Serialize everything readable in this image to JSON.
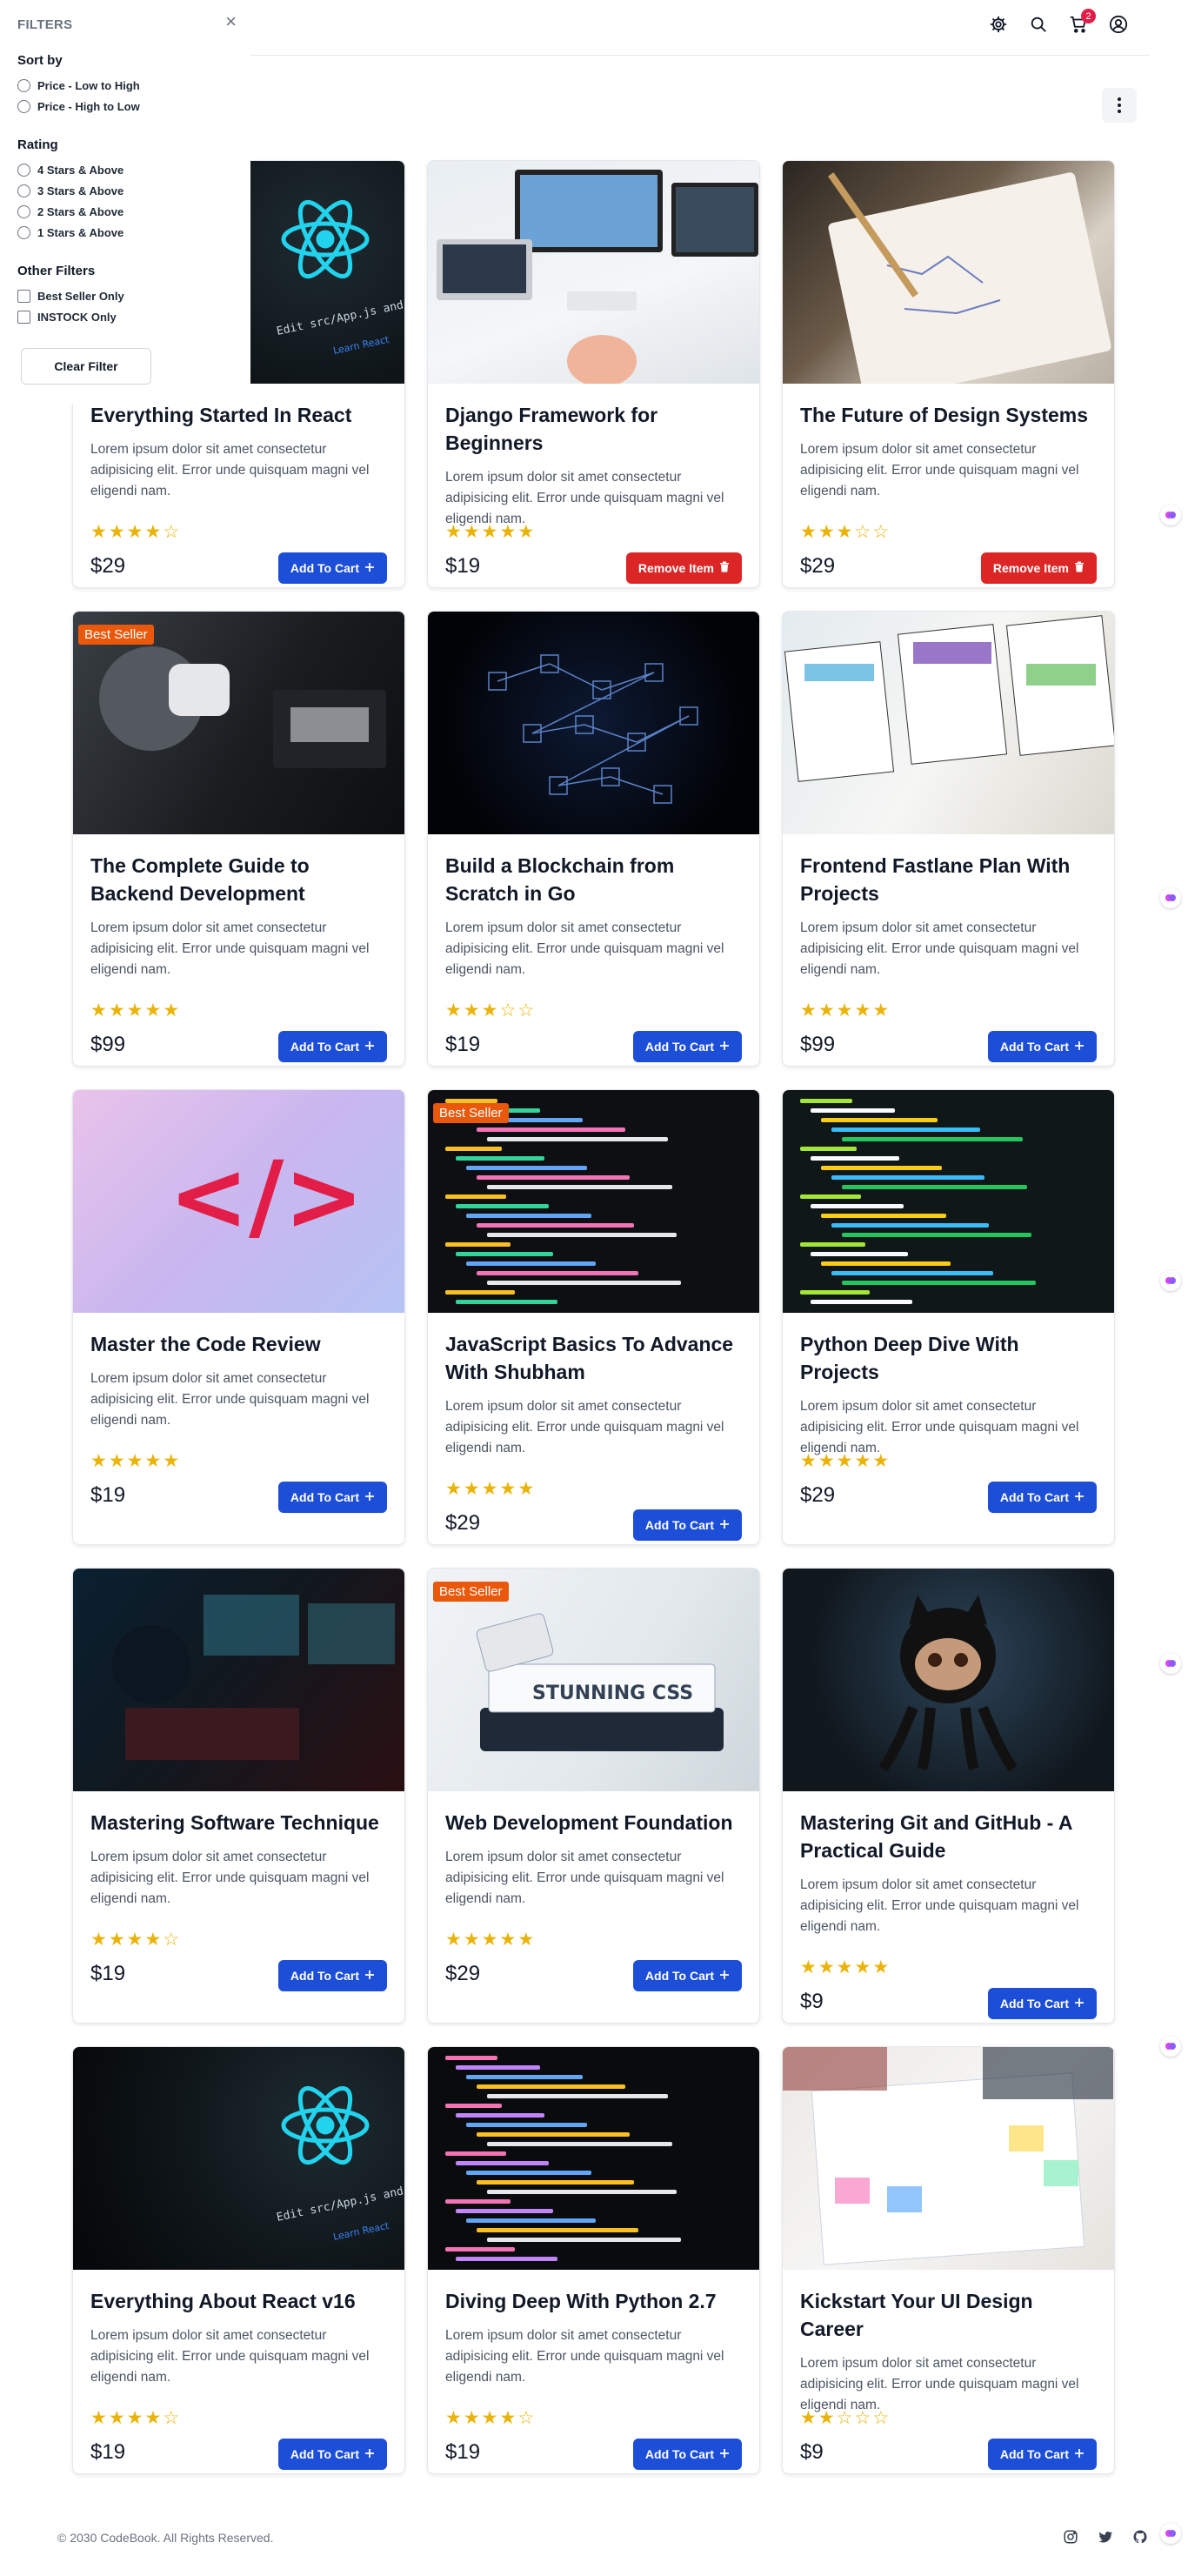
{
  "sidebar": {
    "title": "FILTERS",
    "close_symbol": "×",
    "sort_title": "Sort by",
    "sort_options": [
      "Price - Low to High",
      "Price - High to Low"
    ],
    "rating_title": "Rating",
    "rating_options": [
      "4 Stars & Above",
      "3 Stars & Above",
      "2 Stars & Above",
      "1 Stars & Above"
    ],
    "other_title": "Other Filters",
    "other_options": [
      "Best Seller Only",
      "INSTOCK Only"
    ],
    "clear_label": "Clear Filter"
  },
  "header": {
    "icons": [
      "gear-icon",
      "search-icon",
      "cart-icon",
      "user-icon"
    ],
    "cart_count": "2"
  },
  "products": [
    {
      "title": "Everything Started In React",
      "desc": "Lorem ipsum dolor sit amet consectetur adipisicing elit. Error unde quisquam magni vel eligendi nam.",
      "rating": 4,
      "price": "$29",
      "button": "Add To Cart",
      "in_cart": false,
      "best_seller": false,
      "image": "react-atom-image"
    },
    {
      "title": "Django Framework for Beginners",
      "desc": "Lorem ipsum dolor sit amet consectetur adipisicing elit. Error unde quisquam magni vel eligendi nam.",
      "rating": 5,
      "price": "$19",
      "button": "Remove Item",
      "in_cart": true,
      "best_seller": false,
      "image": "desk-setup-image"
    },
    {
      "title": "The Future of Design Systems",
      "desc": "Lorem ipsum dolor sit amet consectetur adipisicing elit. Error unde quisquam magni vel eligendi nam.",
      "rating": 3,
      "price": "$29",
      "button": "Remove Item",
      "in_cart": true,
      "best_seller": false,
      "image": "sketchbook-image"
    },
    {
      "title": "The Complete Guide to Backend Development",
      "desc": "Lorem ipsum dolor sit amet consectetur adipisicing elit. Error unde quisquam magni vel eligendi nam.",
      "rating": 5,
      "price": "$99",
      "button": "Add To Cart",
      "in_cart": false,
      "best_seller": true,
      "best_seller_label": "Best Seller",
      "image": "vr-headset-image"
    },
    {
      "title": "Build a Blockchain from Scratch in Go",
      "desc": "Lorem ipsum dolor sit amet consectetur adipisicing elit. Error unde quisquam magni vel eligendi nam.",
      "rating": 3,
      "price": "$19",
      "button": "Add To Cart",
      "in_cart": false,
      "best_seller": false,
      "image": "blockchain-image"
    },
    {
      "title": "Frontend Fastlane Plan With Projects",
      "desc": "Lorem ipsum dolor sit amet consectetur adipisicing elit. Error unde quisquam magni vel eligendi nam.",
      "rating": 5,
      "price": "$99",
      "button": "Add To Cart",
      "in_cart": false,
      "best_seller": false,
      "image": "wireframe-image"
    },
    {
      "title": "Master the Code Review",
      "desc": "Lorem ipsum dolor sit amet consectetur adipisicing elit. Error unde quisquam magni vel eligendi nam.",
      "rating": 5,
      "price": "$19",
      "button": "Add To Cart",
      "in_cart": false,
      "best_seller": false,
      "image": "code-symbol-image"
    },
    {
      "title": "JavaScript Basics To Advance With Shubham",
      "desc": "Lorem ipsum dolor sit amet consectetur adipisicing elit. Error unde quisquam magni vel eligendi nam.",
      "rating": 5,
      "price": "$29",
      "button": "Add To Cart",
      "in_cart": false,
      "best_seller": true,
      "best_seller_label": "Best Seller",
      "image": "js-code-image"
    },
    {
      "title": "Python Deep Dive With Projects",
      "desc": "Lorem ipsum dolor sit amet consectetur adipisicing elit. Error unde quisquam magni vel eligendi nam.",
      "rating": 5,
      "price": "$29",
      "button": "Add To Cart",
      "in_cart": false,
      "best_seller": false,
      "image": "python-code-image"
    },
    {
      "title": "Mastering Software Technique",
      "desc": "Lorem ipsum dolor sit amet consectetur adipisicing elit. Error unde quisquam magni vel eligendi nam.",
      "rating": 4,
      "price": "$19",
      "button": "Add To Cart",
      "in_cart": false,
      "best_seller": false,
      "image": "developer-desk-image"
    },
    {
      "title": "Web Development Foundation",
      "desc": "Lorem ipsum dolor sit amet consectetur adipisicing elit. Error unde quisquam magni vel eligendi nam.",
      "rating": 5,
      "price": "$29",
      "button": "Add To Cart",
      "in_cart": false,
      "best_seller": true,
      "best_seller_label": "Best Seller",
      "image": "css-book-image"
    },
    {
      "title": "Mastering Git and GitHub - A Practical Guide",
      "desc": "Lorem ipsum dolor sit amet consectetur adipisicing elit. Error unde quisquam magni vel eligendi nam.",
      "rating": 5,
      "price": "$9",
      "button": "Add To Cart",
      "in_cart": false,
      "best_seller": false,
      "image": "octocat-image"
    },
    {
      "title": "Everything About React v16",
      "desc": "Lorem ipsum dolor sit amet consectetur adipisicing elit. Error unde quisquam magni vel eligendi nam.",
      "rating": 4,
      "price": "$19",
      "button": "Add To Cart",
      "in_cart": false,
      "best_seller": false,
      "image": "react-atom-image"
    },
    {
      "title": "Diving Deep With Python 2.7",
      "desc": "Lorem ipsum dolor sit amet consectetur adipisicing elit. Error unde quisquam magni vel eligendi nam.",
      "rating": 4,
      "price": "$19",
      "button": "Add To Cart",
      "in_cart": false,
      "best_seller": false,
      "image": "python-code-image"
    },
    {
      "title": "Kickstart Your UI Design Career",
      "desc": "Lorem ipsum dolor sit amet consectetur adipisicing elit. Error unde quisquam magni vel eligendi nam.",
      "rating": 2,
      "price": "$9",
      "button": "Add To Cart",
      "in_cart": false,
      "best_seller": false,
      "image": "ui-sketch-image"
    }
  ],
  "footer": {
    "copyright": "© 2030 CodeBook. All Rights Reserved.",
    "icons": [
      "instagram-icon",
      "twitter-icon",
      "github-icon"
    ]
  },
  "colors": {
    "primary": "#1d4ed8",
    "danger": "#dc2626",
    "star": "#eab308",
    "badge": "#ea580c"
  }
}
